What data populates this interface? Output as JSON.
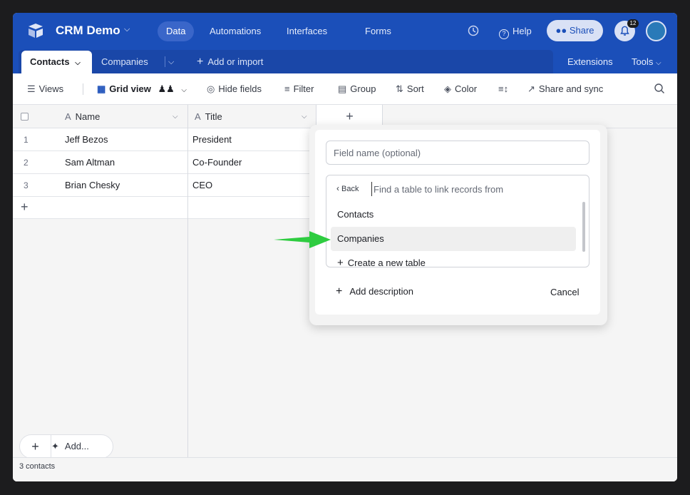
{
  "topbar": {
    "title": "CRM Demo",
    "nav": [
      "Data",
      "Automations",
      "Interfaces",
      "Forms"
    ],
    "help_label": "Help",
    "share_label": "Share",
    "notification_count": "12",
    "brand_color": "#1b4fb9"
  },
  "tabs": {
    "items": [
      "Contacts",
      "Companies"
    ],
    "add_label": "Add or import",
    "extensions_label": "Extensions",
    "tools_label": "Tools"
  },
  "toolbar": {
    "views_label": "Views",
    "grid_view_label": "Grid view",
    "hide_fields_label": "Hide fields",
    "filter_label": "Filter",
    "group_label": "Group",
    "sort_label": "Sort",
    "color_label": "Color",
    "share_sync_label": "Share and sync"
  },
  "grid": {
    "columns": [
      "Name",
      "Title"
    ],
    "rows": [
      {
        "num": "1",
        "name": "Jeff Bezos",
        "title": "President"
      },
      {
        "num": "2",
        "name": "Sam Altman",
        "title": "Co-Founder"
      },
      {
        "num": "3",
        "name": "Brian Chesky",
        "title": "CEO"
      }
    ],
    "record_count": "3 contacts",
    "add_label": "Add..."
  },
  "dialog": {
    "field_name_placeholder": "Field name (optional)",
    "back_label": "Back",
    "search_placeholder": "Find a table to link records from",
    "options": [
      "Contacts",
      "Companies"
    ],
    "create_label": "Create a new table",
    "add_description_label": "Add description",
    "cancel_label": "Cancel"
  },
  "annotation": {
    "arrow_color": "#2ecc40"
  }
}
